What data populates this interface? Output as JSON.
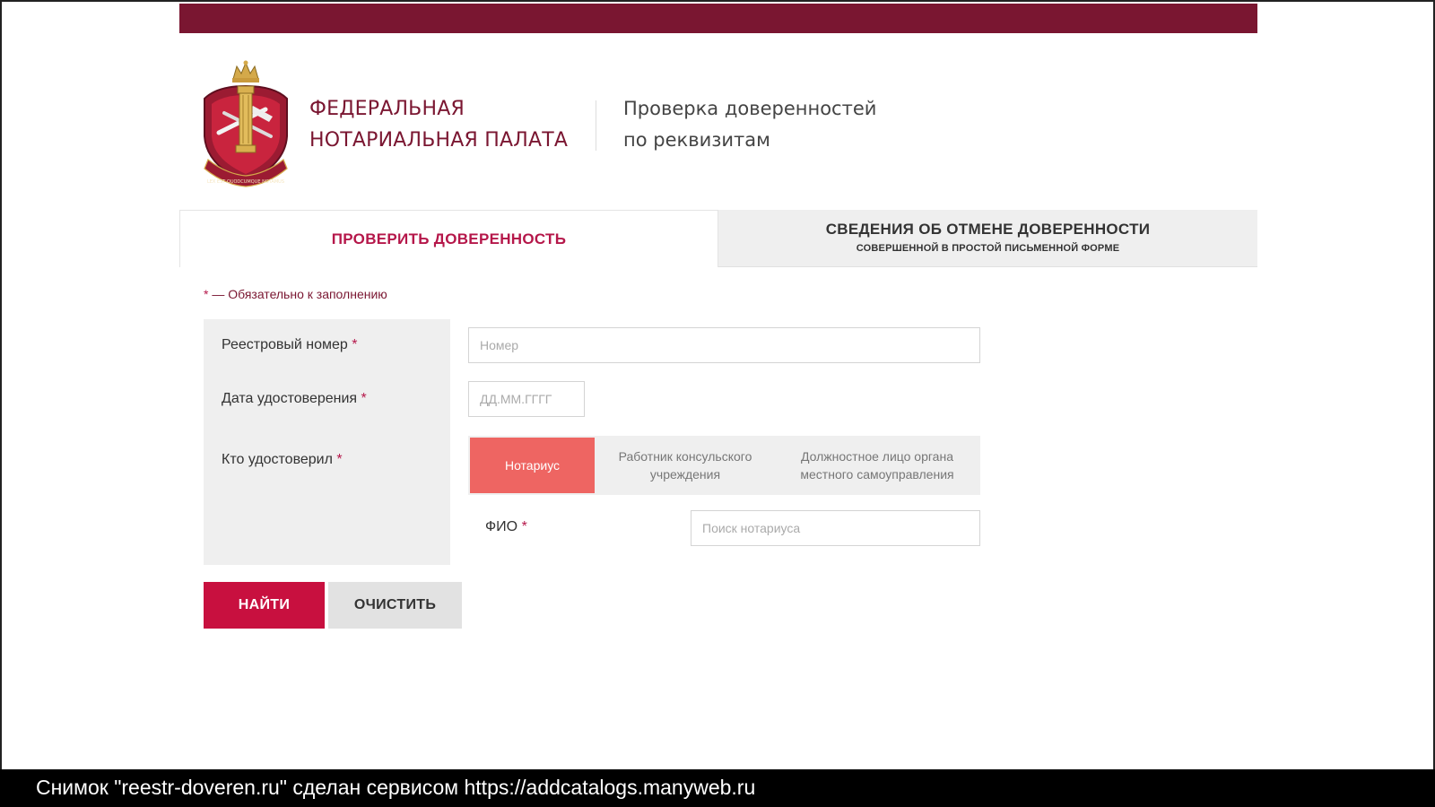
{
  "header": {
    "org_name_line1": "ФЕДЕРАЛЬНАЯ",
    "org_name_line2": "НОТАРИАЛЬНАЯ ПАЛАТА",
    "service_title_line1": "Проверка доверенностей",
    "service_title_line2": "по реквизитам",
    "emblem_text": "LEX EST QUODCUMQUE NOTAMUS"
  },
  "tabs": [
    {
      "label": "ПРОВЕРИТЬ ДОВЕРЕННОСТЬ",
      "active": true
    },
    {
      "label": "СВЕДЕНИЯ ОБ ОТМЕНЕ ДОВЕРЕННОСТИ",
      "sublabel": "СОВЕРШЕННОЙ В ПРОСТОЙ ПИСЬМЕННОЙ ФОРМЕ",
      "active": false
    }
  ],
  "form": {
    "required_star": "*",
    "required_note": " — Обязательно к заполнению",
    "registry_number": {
      "label": "Реестровый номер",
      "placeholder": "Номер",
      "value": ""
    },
    "certification_date": {
      "label": "Дата удостоверения",
      "placeholder": "ДД.ММ.ГГГГ",
      "value": ""
    },
    "certified_by": {
      "label": "Кто удостоверил",
      "options": [
        {
          "label": "Нотариус",
          "selected": true
        },
        {
          "label": "Работник консульского учреждения",
          "selected": false
        },
        {
          "label": "Должностное лицо органа местного самоуправления",
          "selected": false
        }
      ]
    },
    "fio": {
      "label": "ФИО",
      "placeholder": "Поиск нотариуса",
      "value": ""
    }
  },
  "buttons": {
    "find": "НАЙТИ",
    "clear": "ОЧИСТИТЬ"
  },
  "caption": "Снимок \"reestr-doveren.ru\" сделан сервисом https://addcatalogs.manyweb.ru",
  "colors": {
    "brand": "#7a1631",
    "accent": "#c8103f",
    "toggle_active": "#ee6562",
    "panel_bg": "#efefef"
  }
}
